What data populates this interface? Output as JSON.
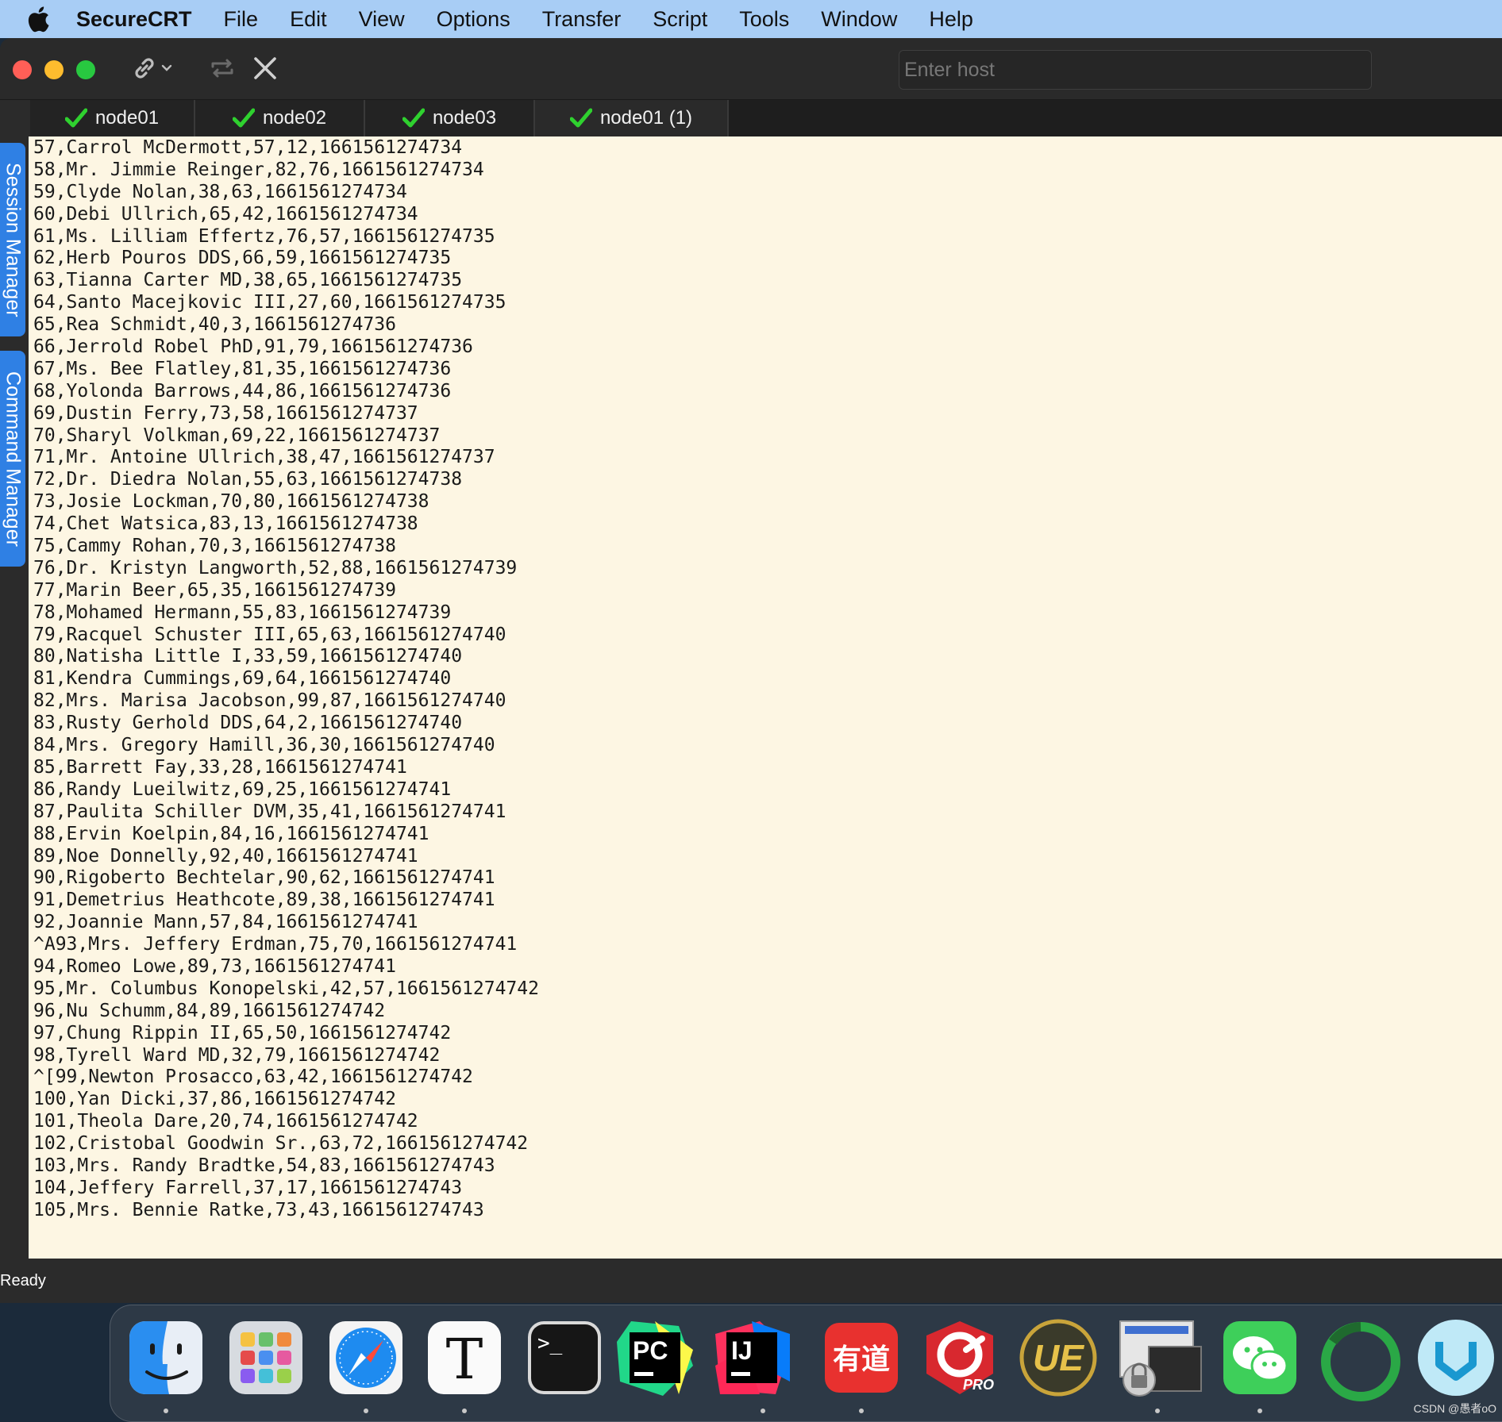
{
  "menubar": {
    "apple_icon": "apple-logo-icon",
    "app_name": "SecureCRT",
    "items": [
      "File",
      "Edit",
      "View",
      "Options",
      "Transfer",
      "Script",
      "Tools",
      "Window",
      "Help"
    ]
  },
  "toolbar": {
    "host_placeholder": "Enter host"
  },
  "tabs": [
    {
      "label": "node01",
      "status": "connected"
    },
    {
      "label": "node02",
      "status": "connected"
    },
    {
      "label": "node03",
      "status": "connected"
    },
    {
      "label": "node01 (1)",
      "status": "connected"
    }
  ],
  "side_panels": {
    "session_manager": "Session Manager",
    "command_manager": "Command Manager"
  },
  "terminal": {
    "lines": [
      "57,Carrol McDermott,57,12,1661561274734",
      "58,Mr. Jimmie Reinger,82,76,1661561274734",
      "59,Clyde Nolan,38,63,1661561274734",
      "60,Debi Ullrich,65,42,1661561274734",
      "61,Ms. Lilliam Effertz,76,57,1661561274735",
      "62,Herb Pouros DDS,66,59,1661561274735",
      "63,Tianna Carter MD,38,65,1661561274735",
      "64,Santo Macejkovic III,27,60,1661561274735",
      "65,Rea Schmidt,40,3,1661561274736",
      "66,Jerrold Robel PhD,91,79,1661561274736",
      "67,Ms. Bee Flatley,81,35,1661561274736",
      "68,Yolonda Barrows,44,86,1661561274736",
      "69,Dustin Ferry,73,58,1661561274737",
      "70,Sharyl Volkman,69,22,1661561274737",
      "71,Mr. Antoine Ullrich,38,47,1661561274737",
      "72,Dr. Diedra Nolan,55,63,1661561274738",
      "73,Josie Lockman,70,80,1661561274738",
      "74,Chet Watsica,83,13,1661561274738",
      "75,Cammy Rohan,70,3,1661561274738",
      "76,Dr. Kristyn Langworth,52,88,1661561274739",
      "77,Marin Beer,65,35,1661561274739",
      "78,Mohamed Hermann,55,83,1661561274739",
      "79,Racquel Schuster III,65,63,1661561274740",
      "80,Natisha Little I,33,59,1661561274740",
      "81,Kendra Cummings,69,64,1661561274740",
      "82,Mrs. Marisa Jacobson,99,87,1661561274740",
      "83,Rusty Gerhold DDS,64,2,1661561274740",
      "84,Mrs. Gregory Hamill,36,30,1661561274740",
      "85,Barrett Fay,33,28,1661561274741",
      "86,Randy Lueilwitz,69,25,1661561274741",
      "87,Paulita Schiller DVM,35,41,1661561274741",
      "88,Ervin Koelpin,84,16,1661561274741",
      "89,Noe Donnelly,92,40,1661561274741",
      "90,Rigoberto Bechtelar,90,62,1661561274741",
      "91,Demetrius Heathcote,89,38,1661561274741",
      "92,Joannie Mann,57,84,1661561274741",
      "^A93,Mrs. Jeffery Erdman,75,70,1661561274741",
      "94,Romeo Lowe,89,73,1661561274741",
      "95,Mr. Columbus Konopelski,42,57,1661561274742",
      "96,Nu Schumm,84,89,1661561274742",
      "97,Chung Rippin II,65,50,1661561274742",
      "98,Tyrell Ward MD,32,79,1661561274742",
      "^[99,Newton Prosacco,63,42,1661561274742",
      "100,Yan Dicki,37,86,1661561274742",
      "101,Theola Dare,20,74,1661561274742",
      "102,Cristobal Goodwin Sr.,63,72,1661561274742",
      "103,Mrs. Randy Bradtke,54,83,1661561274743",
      "104,Jeffery Farrell,37,17,1661561274743",
      "105,Mrs. Bennie Ratke,73,43,1661561274743"
    ]
  },
  "status": {
    "text": "Ready"
  },
  "dock": {
    "apps": [
      {
        "name": "finder-icon",
        "running": true
      },
      {
        "name": "launchpad-icon",
        "running": false
      },
      {
        "name": "safari-icon",
        "running": true
      },
      {
        "name": "typora-icon",
        "running": true
      },
      {
        "name": "terminal-icon",
        "running": false
      },
      {
        "name": "pycharm-icon",
        "running": false
      },
      {
        "name": "intellij-idea-icon",
        "running": true
      },
      {
        "name": "youdao-dictionary-icon",
        "running": true
      },
      {
        "name": "crossover-pro-icon",
        "running": false
      },
      {
        "name": "ultraedit-icon",
        "running": false
      },
      {
        "name": "securecrt-icon",
        "running": true
      },
      {
        "name": "wechat-icon",
        "running": true
      },
      {
        "name": "pycharm-ring-icon",
        "running": false
      },
      {
        "name": "shield-app-icon",
        "running": false
      }
    ],
    "labels": {
      "youdao": "有道",
      "pycharm": "PC",
      "intellij": "IJ",
      "typora": "T",
      "terminal": ">_",
      "crossover": "PRO",
      "ultraedit": "UE"
    }
  },
  "watermark": {
    "text": "CSDN @愚者oO"
  }
}
